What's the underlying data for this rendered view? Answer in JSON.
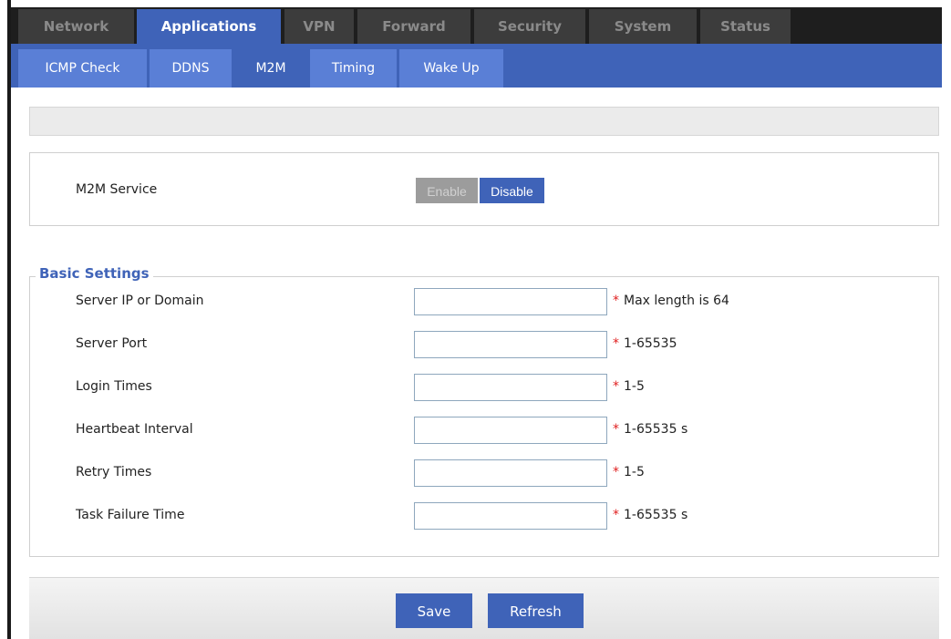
{
  "main_tabs": [
    {
      "label": "Network",
      "active": false
    },
    {
      "label": "Applications",
      "active": true
    },
    {
      "label": "VPN",
      "active": false
    },
    {
      "label": "Forward",
      "active": false
    },
    {
      "label": "Security",
      "active": false
    },
    {
      "label": "System",
      "active": false
    },
    {
      "label": "Status",
      "active": false
    }
  ],
  "sub_tabs": [
    {
      "label": "ICMP Check",
      "active": false
    },
    {
      "label": "DDNS",
      "active": false
    },
    {
      "label": "M2M",
      "active": true
    },
    {
      "label": "Timing",
      "active": false
    },
    {
      "label": "Wake Up",
      "active": false
    }
  ],
  "service": {
    "label": "M2M Service",
    "enable_label": "Enable",
    "disable_label": "Disable",
    "selected": "Disable"
  },
  "basic_settings": {
    "legend": "Basic Settings",
    "fields": [
      {
        "label": "Server IP or Domain",
        "value": "",
        "hint": "Max length is 64"
      },
      {
        "label": "Server Port",
        "value": "",
        "hint": "1-65535"
      },
      {
        "label": "Login Times",
        "value": "",
        "hint": "1-5"
      },
      {
        "label": "Heartbeat Interval",
        "value": "",
        "hint": "1-65535 s"
      },
      {
        "label": "Retry Times",
        "value": "",
        "hint": "1-5"
      },
      {
        "label": "Task Failure Time",
        "value": "",
        "hint": "1-65535 s"
      }
    ],
    "required_mark": "*"
  },
  "footer": {
    "save_label": "Save",
    "refresh_label": "Refresh"
  },
  "colors": {
    "accent": "#3f63b8",
    "tab_inactive": "#3c3c3c",
    "subtab_inactive": "#5a7fd6",
    "required": "#e02020"
  }
}
